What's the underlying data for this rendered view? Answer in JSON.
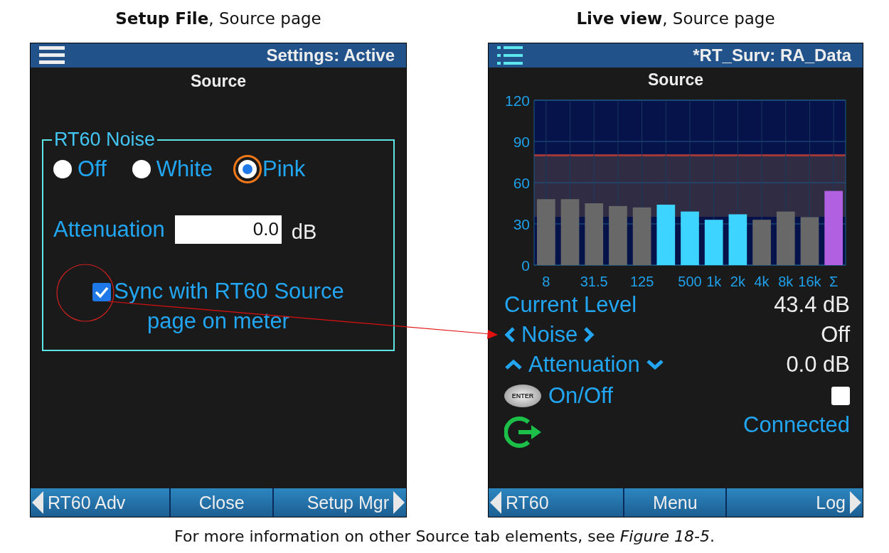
{
  "setup_panel": {
    "caption": "**Setup File**, Source page",
    "title": "Settings: Active",
    "page": "Source",
    "group_label": "RT60 Noise",
    "noise_options": [
      {
        "label": "Off",
        "selected": false,
        "focused": false
      },
      {
        "label": "White",
        "selected": false,
        "focused": false
      },
      {
        "label": "Pink",
        "selected": true,
        "focused": true
      }
    ],
    "attenuation": {
      "label": "Attenuation",
      "value": "0.0",
      "unit": "dB"
    },
    "sync": {
      "label": "Sync with RT60 Source page on meter",
      "checked": true
    },
    "softkeys": [
      "RT60 Adv",
      "Close",
      "Setup Mgr"
    ]
  },
  "live_panel": {
    "caption": "**Live view**, Source page",
    "title": "*RT_Surv: RA_Data",
    "page": "Source",
    "chart_data": {
      "type": "bar",
      "grid": true,
      "categories": [
        "8",
        null,
        "31.5",
        null,
        "125",
        null,
        "500",
        "1k",
        "2k",
        "4k",
        "8k",
        "16k",
        "Σ"
      ],
      "ylim": [
        0,
        120
      ],
      "yticks": [
        0,
        30,
        60,
        90,
        120
      ],
      "series": [
        {
          "color": "#686868",
          "values": [
            48,
            48,
            45,
            43,
            42,
            null,
            null,
            null,
            null,
            33,
            39,
            35,
            null
          ]
        },
        {
          "color": "#3dd4ff",
          "values": [
            null,
            null,
            null,
            null,
            null,
            44,
            39,
            33,
            37,
            null,
            null,
            null,
            null
          ]
        },
        {
          "color": "#b060e0",
          "values": [
            null,
            null,
            null,
            null,
            null,
            null,
            null,
            null,
            null,
            null,
            null,
            null,
            54
          ]
        }
      ]
    },
    "rows": [
      {
        "kind": "reading",
        "label": "Current Level",
        "value": "43.4 dB"
      },
      {
        "kind": "choice",
        "label": "Noise",
        "value": "Off"
      },
      {
        "kind": "stepper",
        "label": "Attenuation",
        "value": "0.0 dB"
      },
      {
        "kind": "toggle",
        "key": "ENTER",
        "label": "On/Off",
        "checked": false
      },
      {
        "kind": "status",
        "value": "Connected"
      }
    ],
    "softkeys": [
      "RT60",
      "Menu",
      "Log"
    ]
  },
  "footnote": "For more information on other Source tab elements, see *Figure 18-5*."
}
